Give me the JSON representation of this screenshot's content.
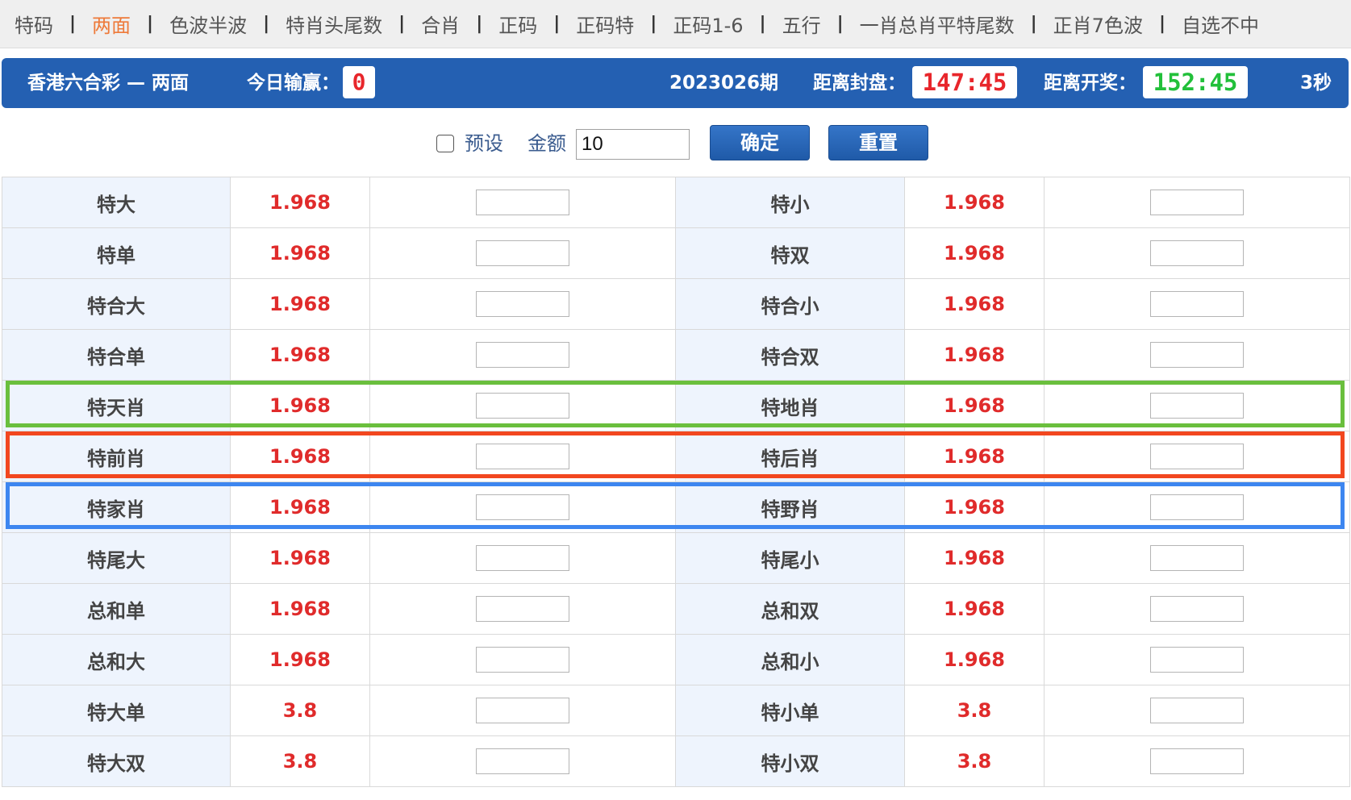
{
  "nav": {
    "items": [
      "特码",
      "两面",
      "色波半波",
      "特肖头尾数",
      "合肖",
      "正码",
      "正码特",
      "正码1-6",
      "五行",
      "一肖总肖平特尾数",
      "正肖7色波",
      "自选不中"
    ],
    "active_index": 1,
    "separator": "|"
  },
  "header": {
    "title": "香港六合彩 — 两面",
    "today_label": "今日输赢：",
    "today_value": "0",
    "period": "2023026期",
    "close_label": "距离封盘：",
    "close_time": "147:45",
    "open_label": "距离开奖：",
    "open_time": "152:45",
    "seconds": "3秒"
  },
  "controls": {
    "preset_label": "预设",
    "preset_checked": false,
    "amount_label": "金额",
    "amount_value": "10",
    "confirm_label": "确定",
    "reset_label": "重置"
  },
  "rows": [
    {
      "left": {
        "name": "特大",
        "odds": "1.968"
      },
      "right": {
        "name": "特小",
        "odds": "1.968"
      }
    },
    {
      "left": {
        "name": "特单",
        "odds": "1.968"
      },
      "right": {
        "name": "特双",
        "odds": "1.968"
      }
    },
    {
      "left": {
        "name": "特合大",
        "odds": "1.968"
      },
      "right": {
        "name": "特合小",
        "odds": "1.968"
      }
    },
    {
      "left": {
        "name": "特合单",
        "odds": "1.968"
      },
      "right": {
        "name": "特合双",
        "odds": "1.968"
      }
    },
    {
      "left": {
        "name": "特天肖",
        "odds": "1.968"
      },
      "right": {
        "name": "特地肖",
        "odds": "1.968"
      }
    },
    {
      "left": {
        "name": "特前肖",
        "odds": "1.968"
      },
      "right": {
        "name": "特后肖",
        "odds": "1.968"
      }
    },
    {
      "left": {
        "name": "特家肖",
        "odds": "1.968"
      },
      "right": {
        "name": "特野肖",
        "odds": "1.968"
      }
    },
    {
      "left": {
        "name": "特尾大",
        "odds": "1.968"
      },
      "right": {
        "name": "特尾小",
        "odds": "1.968"
      }
    },
    {
      "left": {
        "name": "总和单",
        "odds": "1.968"
      },
      "right": {
        "name": "总和双",
        "odds": "1.968"
      }
    },
    {
      "left": {
        "name": "总和大",
        "odds": "1.968"
      },
      "right": {
        "name": "总和小",
        "odds": "1.968"
      }
    },
    {
      "left": {
        "name": "特大单",
        "odds": "3.8"
      },
      "right": {
        "name": "特小单",
        "odds": "3.8"
      }
    },
    {
      "left": {
        "name": "特大双",
        "odds": "3.8"
      },
      "right": {
        "name": "特小双",
        "odds": "3.8"
      }
    }
  ],
  "highlights": [
    {
      "row_index": 4,
      "color": "#6abf3d"
    },
    {
      "row_index": 5,
      "color": "#f2471f"
    },
    {
      "row_index": 6,
      "color": "#3d86f0"
    }
  ],
  "colors": {
    "header_bg": "#2460b2",
    "odds_text": "#e02b2b",
    "nav_active": "#ee7a3a",
    "name_cell_bg": "#eef4fd",
    "open_time_text": "#22c03a"
  }
}
